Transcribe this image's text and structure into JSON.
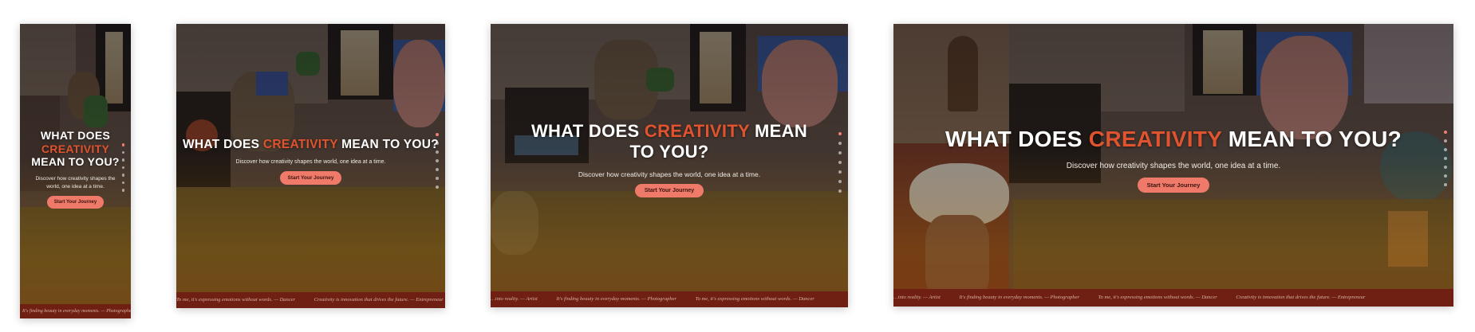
{
  "hero": {
    "headline_before": "WHAT DOES ",
    "headline_accent": "CREATIVITY",
    "headline_after": " MEAN TO YOU?",
    "subtitle": "Discover how creativity shapes the world, one idea at a time.",
    "cta_label": "Start Your Journey"
  },
  "ticker": {
    "quotes": [
      "…into reality. — Artist",
      "It's finding beauty in everyday moments. — Photographer",
      "To me, it's expressing emotions without words. — Dancer",
      "Creativity is innovation that drives the future. — Entrepreneur"
    ]
  },
  "nav_dots": {
    "count": 7,
    "active_index": 0
  },
  "colors": {
    "accent": "#e0532f",
    "cta_bg": "#f07a6a",
    "ticker_bg": "#6f2012",
    "active_dot": "#f08070"
  }
}
